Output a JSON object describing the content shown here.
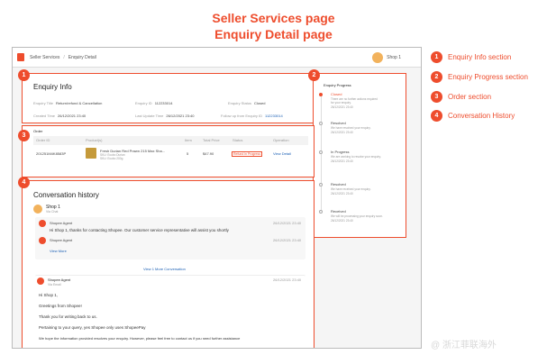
{
  "headings": {
    "line1": "Seller Services page",
    "line2": "Enquiry Detail page"
  },
  "topbar": {
    "crumb_root": "Seller Services",
    "crumb_sep": "/",
    "crumb_current": "Enquiry Detail",
    "shop_name": "Shop 1"
  },
  "badges": {
    "b1": "1",
    "b2": "2",
    "b3": "3",
    "b4": "4"
  },
  "legend": [
    {
      "num": "1",
      "label": "Enquiry Info section"
    },
    {
      "num": "2",
      "label": "Enquiry Progress section"
    },
    {
      "num": "3",
      "label": "Order section"
    },
    {
      "num": "4",
      "label": "Conversation History"
    }
  ],
  "enquiry_info": {
    "title": "Enquiry Info",
    "title_label": "Enquiry Title",
    "title_value": "Return/refund & Cancellation",
    "id_label": "Enquiry ID",
    "id_value": "112233014",
    "status_label": "Enquiry Status",
    "status_value": "Closed",
    "created_label": "Created Time",
    "created_value": "26/12/2021 23:40",
    "updated_label": "Last Update Time",
    "updated_value": "26/12/2021 23:40",
    "follow_label": "Follow up from Enquiry ID",
    "follow_value": "112233014"
  },
  "progress": {
    "title": "Enquiry Progress",
    "steps": [
      {
        "name": "Closed",
        "desc": "There are no further actions required",
        "desc2": "for your enquiry.",
        "time": "26/12/2021 23:40"
      },
      {
        "name": "Resolved",
        "desc": "We have resolved your enquiry.",
        "time": "26/12/2021 23:40"
      },
      {
        "name": "In Progress",
        "desc": "We are working to resolve your enquiry.",
        "time": "26/12/2021 23:40"
      },
      {
        "name": "Resolved",
        "desc": "We have received your enquiry.",
        "time": "26/12/2021 23:40"
      },
      {
        "name": "Received",
        "desc": "We will be processing your enquiry soon.",
        "time": "26/12/2021 23:40"
      }
    ]
  },
  "order": {
    "title": "Order",
    "headers": [
      "Order ID",
      "Product(s)",
      "Item",
      "Total Price",
      "Status",
      "Operation"
    ],
    "row": {
      "order_id": "201251M4K8583P",
      "product": "Fresh Durian Red Prawn 215 Max Sha...",
      "variation": "SKU: Ecubo Durian",
      "variation2": "SKU: Ecubo 200g",
      "item": "5",
      "price": "$47.90",
      "status": "Refund in Progress",
      "operation": "View Detail"
    }
  },
  "conversation": {
    "title": "Conversation history",
    "shop_name": "Shop 1",
    "shop_sub": "Via Chat",
    "msg1_sender": "Shopee Agent",
    "msg1_time": "26/12/2021 23:40",
    "msg1_text": "Hi Shop 1, thanks for contacting Shopee. Our customer service representative will assist you shortly",
    "msg2_sender": "Shopee Agent",
    "msg2_time": "26/12/2021 23:40",
    "view_more": "View More",
    "view_more_conv": "View 1 More Conversation",
    "agent_name": "Shopee Agent",
    "agent_sub": "Via Email",
    "agent_time": "26/12/2021 23:40",
    "agent_lines": [
      "Hi Shop 1,",
      "Greetings from Shopee!",
      "Thank you for writing back to us.",
      "Pertaining to your query, yes Shopee only uses ShopeePay",
      "We hope the information provided resolves your enquiry. However, please feel free to contact us if you need further assistance"
    ]
  },
  "watermark": "@ 浙江菲联海外",
  "colors": {
    "accent": "#ee4d2d",
    "link": "#1a5fb4"
  }
}
